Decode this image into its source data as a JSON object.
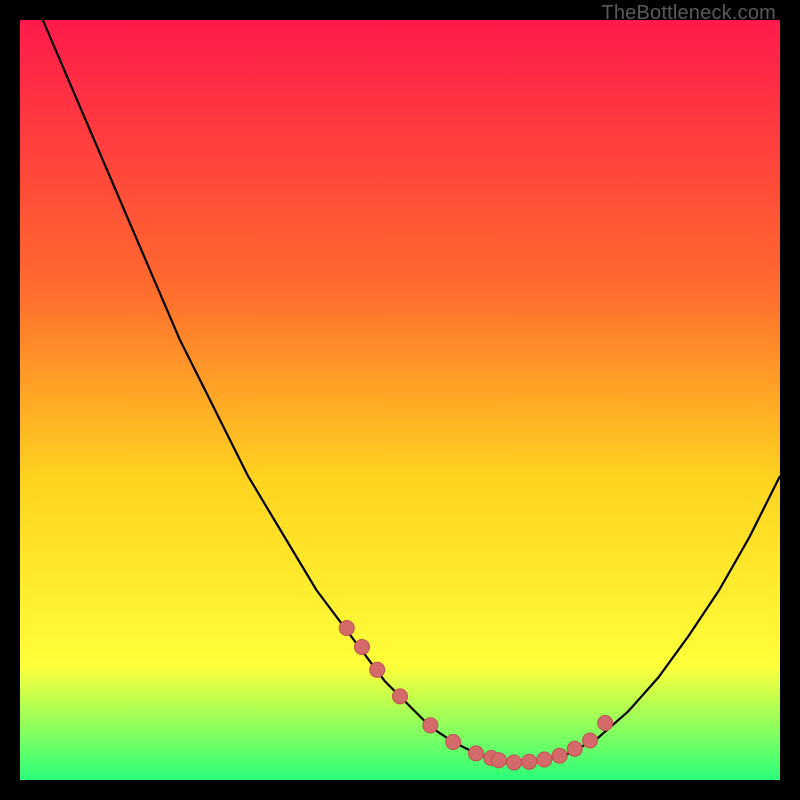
{
  "watermark": "TheBottleneck.com",
  "colors": {
    "gradient_top": "#ff1a4b",
    "gradient_mid1": "#ff6a2e",
    "gradient_mid2": "#ffd21f",
    "gradient_mid3": "#ffff3a",
    "gradient_bottom": "#2bff7a",
    "curve": "#000000",
    "marker_fill": "#d46a6a",
    "marker_stroke": "#c05050",
    "frame": "#000000"
  },
  "chart_data": {
    "type": "line",
    "title": "",
    "xlabel": "",
    "ylabel": "",
    "xlim": [
      0,
      100
    ],
    "ylim": [
      0,
      100
    ],
    "series": [
      {
        "name": "bottleneck-curve",
        "x": [
          3,
          6,
          9,
          12,
          15,
          18,
          21,
          24,
          27,
          30,
          33,
          36,
          39,
          42,
          45,
          48,
          51,
          54,
          57,
          60,
          63,
          65,
          68,
          72,
          76,
          80,
          84,
          88,
          92,
          96,
          100
        ],
        "values": [
          100,
          93,
          86,
          79,
          72,
          65,
          58,
          52,
          46,
          40,
          35,
          30,
          25,
          21,
          17,
          13,
          10,
          7,
          5,
          3.5,
          2.6,
          2.3,
          2.5,
          3.4,
          5.5,
          9,
          13.5,
          19,
          25,
          32,
          40
        ]
      }
    ],
    "markers": {
      "name": "highlight-points",
      "x": [
        43,
        45,
        47,
        50,
        54,
        57,
        60,
        62,
        63,
        65,
        67,
        69,
        71,
        73,
        75,
        77
      ],
      "values": [
        20,
        17.5,
        14.5,
        11,
        7.2,
        5,
        3.5,
        2.9,
        2.6,
        2.3,
        2.4,
        2.7,
        3.2,
        4.1,
        5.2,
        7.5
      ]
    }
  }
}
